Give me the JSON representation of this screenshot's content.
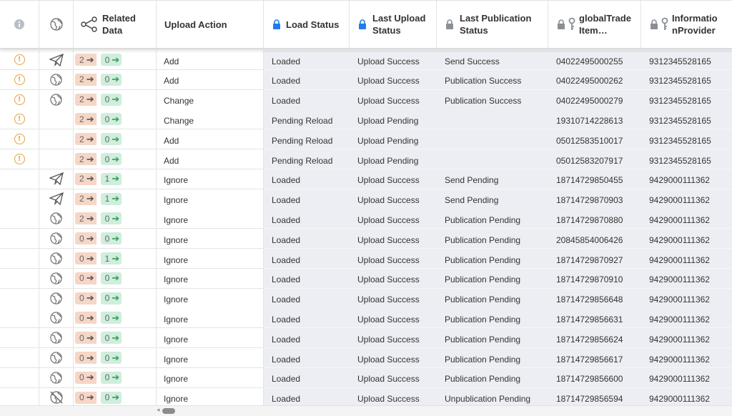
{
  "columns": {
    "info": "",
    "globe": "",
    "related": "Related Data",
    "upload_action": "Upload Action",
    "load_status": "Load Status",
    "last_upload_status": "Last Upload Status",
    "last_publication_status": "Last Publication Status",
    "gtin": "globalTrade Item…",
    "info_provider": "Informatio nProvider"
  },
  "colors": {
    "warning": "#e3a33a",
    "accent_blue": "#1f7de6",
    "pink_chip": "#f6d6c6",
    "green_chip": "#cfeedd"
  },
  "rows": [
    {
      "warn": true,
      "icon": "paper-plane-icon",
      "rel_a": "2",
      "rel_b": "0",
      "action": "Add",
      "load": "Loaded",
      "upload": "Upload Success",
      "pub": "Send Success",
      "gtin": "04022495000255",
      "provider": "9312345528165"
    },
    {
      "warn": true,
      "icon": "globe-icon",
      "rel_a": "2",
      "rel_b": "0",
      "action": "Add",
      "load": "Loaded",
      "upload": "Upload Success",
      "pub": "Publication Success",
      "gtin": "04022495000262",
      "provider": "9312345528165"
    },
    {
      "warn": true,
      "icon": "globe-icon",
      "rel_a": "2",
      "rel_b": "0",
      "action": "Change",
      "load": "Loaded",
      "upload": "Upload Success",
      "pub": "Publication Success",
      "gtin": "04022495000279",
      "provider": "9312345528165"
    },
    {
      "warn": true,
      "icon": "",
      "rel_a": "2",
      "rel_b": "0",
      "action": "Change",
      "load": "Pending Reload",
      "upload": "Upload Pending",
      "pub": "",
      "gtin": "19310714228613",
      "provider": "9312345528165"
    },
    {
      "warn": true,
      "icon": "",
      "rel_a": "2",
      "rel_b": "0",
      "action": "Add",
      "load": "Pending Reload",
      "upload": "Upload Pending",
      "pub": "",
      "gtin": "05012583510017",
      "provider": "9312345528165"
    },
    {
      "warn": true,
      "icon": "",
      "rel_a": "2",
      "rel_b": "0",
      "action": "Add",
      "load": "Pending Reload",
      "upload": "Upload Pending",
      "pub": "",
      "gtin": "05012583207917",
      "provider": "9312345528165"
    },
    {
      "warn": false,
      "icon": "paper-plane-icon",
      "rel_a": "2",
      "rel_b": "1",
      "action": "Ignore",
      "load": "Loaded",
      "upload": "Upload Success",
      "pub": "Send Pending",
      "gtin": "18714729850455",
      "provider": "9429000111362"
    },
    {
      "warn": false,
      "icon": "paper-plane-icon",
      "rel_a": "2",
      "rel_b": "1",
      "action": "Ignore",
      "load": "Loaded",
      "upload": "Upload Success",
      "pub": "Send Pending",
      "gtin": "18714729870903",
      "provider": "9429000111362"
    },
    {
      "warn": false,
      "icon": "globe-icon",
      "rel_a": "2",
      "rel_b": "0",
      "action": "Ignore",
      "load": "Loaded",
      "upload": "Upload Success",
      "pub": "Publication Pending",
      "gtin": "18714729870880",
      "provider": "9429000111362"
    },
    {
      "warn": false,
      "icon": "globe-icon",
      "rel_a": "0",
      "rel_b": "0",
      "action": "Ignore",
      "load": "Loaded",
      "upload": "Upload Success",
      "pub": "Publication Pending",
      "gtin": "20845854006426",
      "provider": "9429000111362"
    },
    {
      "warn": false,
      "icon": "globe-icon",
      "rel_a": "0",
      "rel_b": "1",
      "action": "Ignore",
      "load": "Loaded",
      "upload": "Upload Success",
      "pub": "Publication Pending",
      "gtin": "18714729870927",
      "provider": "9429000111362"
    },
    {
      "warn": false,
      "icon": "globe-icon",
      "rel_a": "0",
      "rel_b": "0",
      "action": "Ignore",
      "load": "Loaded",
      "upload": "Upload Success",
      "pub": "Publication Pending",
      "gtin": "18714729870910",
      "provider": "9429000111362"
    },
    {
      "warn": false,
      "icon": "globe-icon",
      "rel_a": "0",
      "rel_b": "0",
      "action": "Ignore",
      "load": "Loaded",
      "upload": "Upload Success",
      "pub": "Publication Pending",
      "gtin": "18714729856648",
      "provider": "9429000111362"
    },
    {
      "warn": false,
      "icon": "globe-icon",
      "rel_a": "0",
      "rel_b": "0",
      "action": "Ignore",
      "load": "Loaded",
      "upload": "Upload Success",
      "pub": "Publication Pending",
      "gtin": "18714729856631",
      "provider": "9429000111362"
    },
    {
      "warn": false,
      "icon": "globe-icon",
      "rel_a": "0",
      "rel_b": "0",
      "action": "Ignore",
      "load": "Loaded",
      "upload": "Upload Success",
      "pub": "Publication Pending",
      "gtin": "18714729856624",
      "provider": "9429000111362"
    },
    {
      "warn": false,
      "icon": "globe-icon",
      "rel_a": "0",
      "rel_b": "0",
      "action": "Ignore",
      "load": "Loaded",
      "upload": "Upload Success",
      "pub": "Publication Pending",
      "gtin": "18714729856617",
      "provider": "9429000111362"
    },
    {
      "warn": false,
      "icon": "globe-icon",
      "rel_a": "0",
      "rel_b": "0",
      "action": "Ignore",
      "load": "Loaded",
      "upload": "Upload Success",
      "pub": "Publication Pending",
      "gtin": "18714729856600",
      "provider": "9429000111362"
    },
    {
      "warn": false,
      "icon": "globe-crossed-icon",
      "rel_a": "0",
      "rel_b": "0",
      "action": "Ignore",
      "load": "Loaded",
      "upload": "Upload Success",
      "pub": "Unpublication Pending",
      "gtin": "18714729856594",
      "provider": "9429000111362"
    }
  ]
}
